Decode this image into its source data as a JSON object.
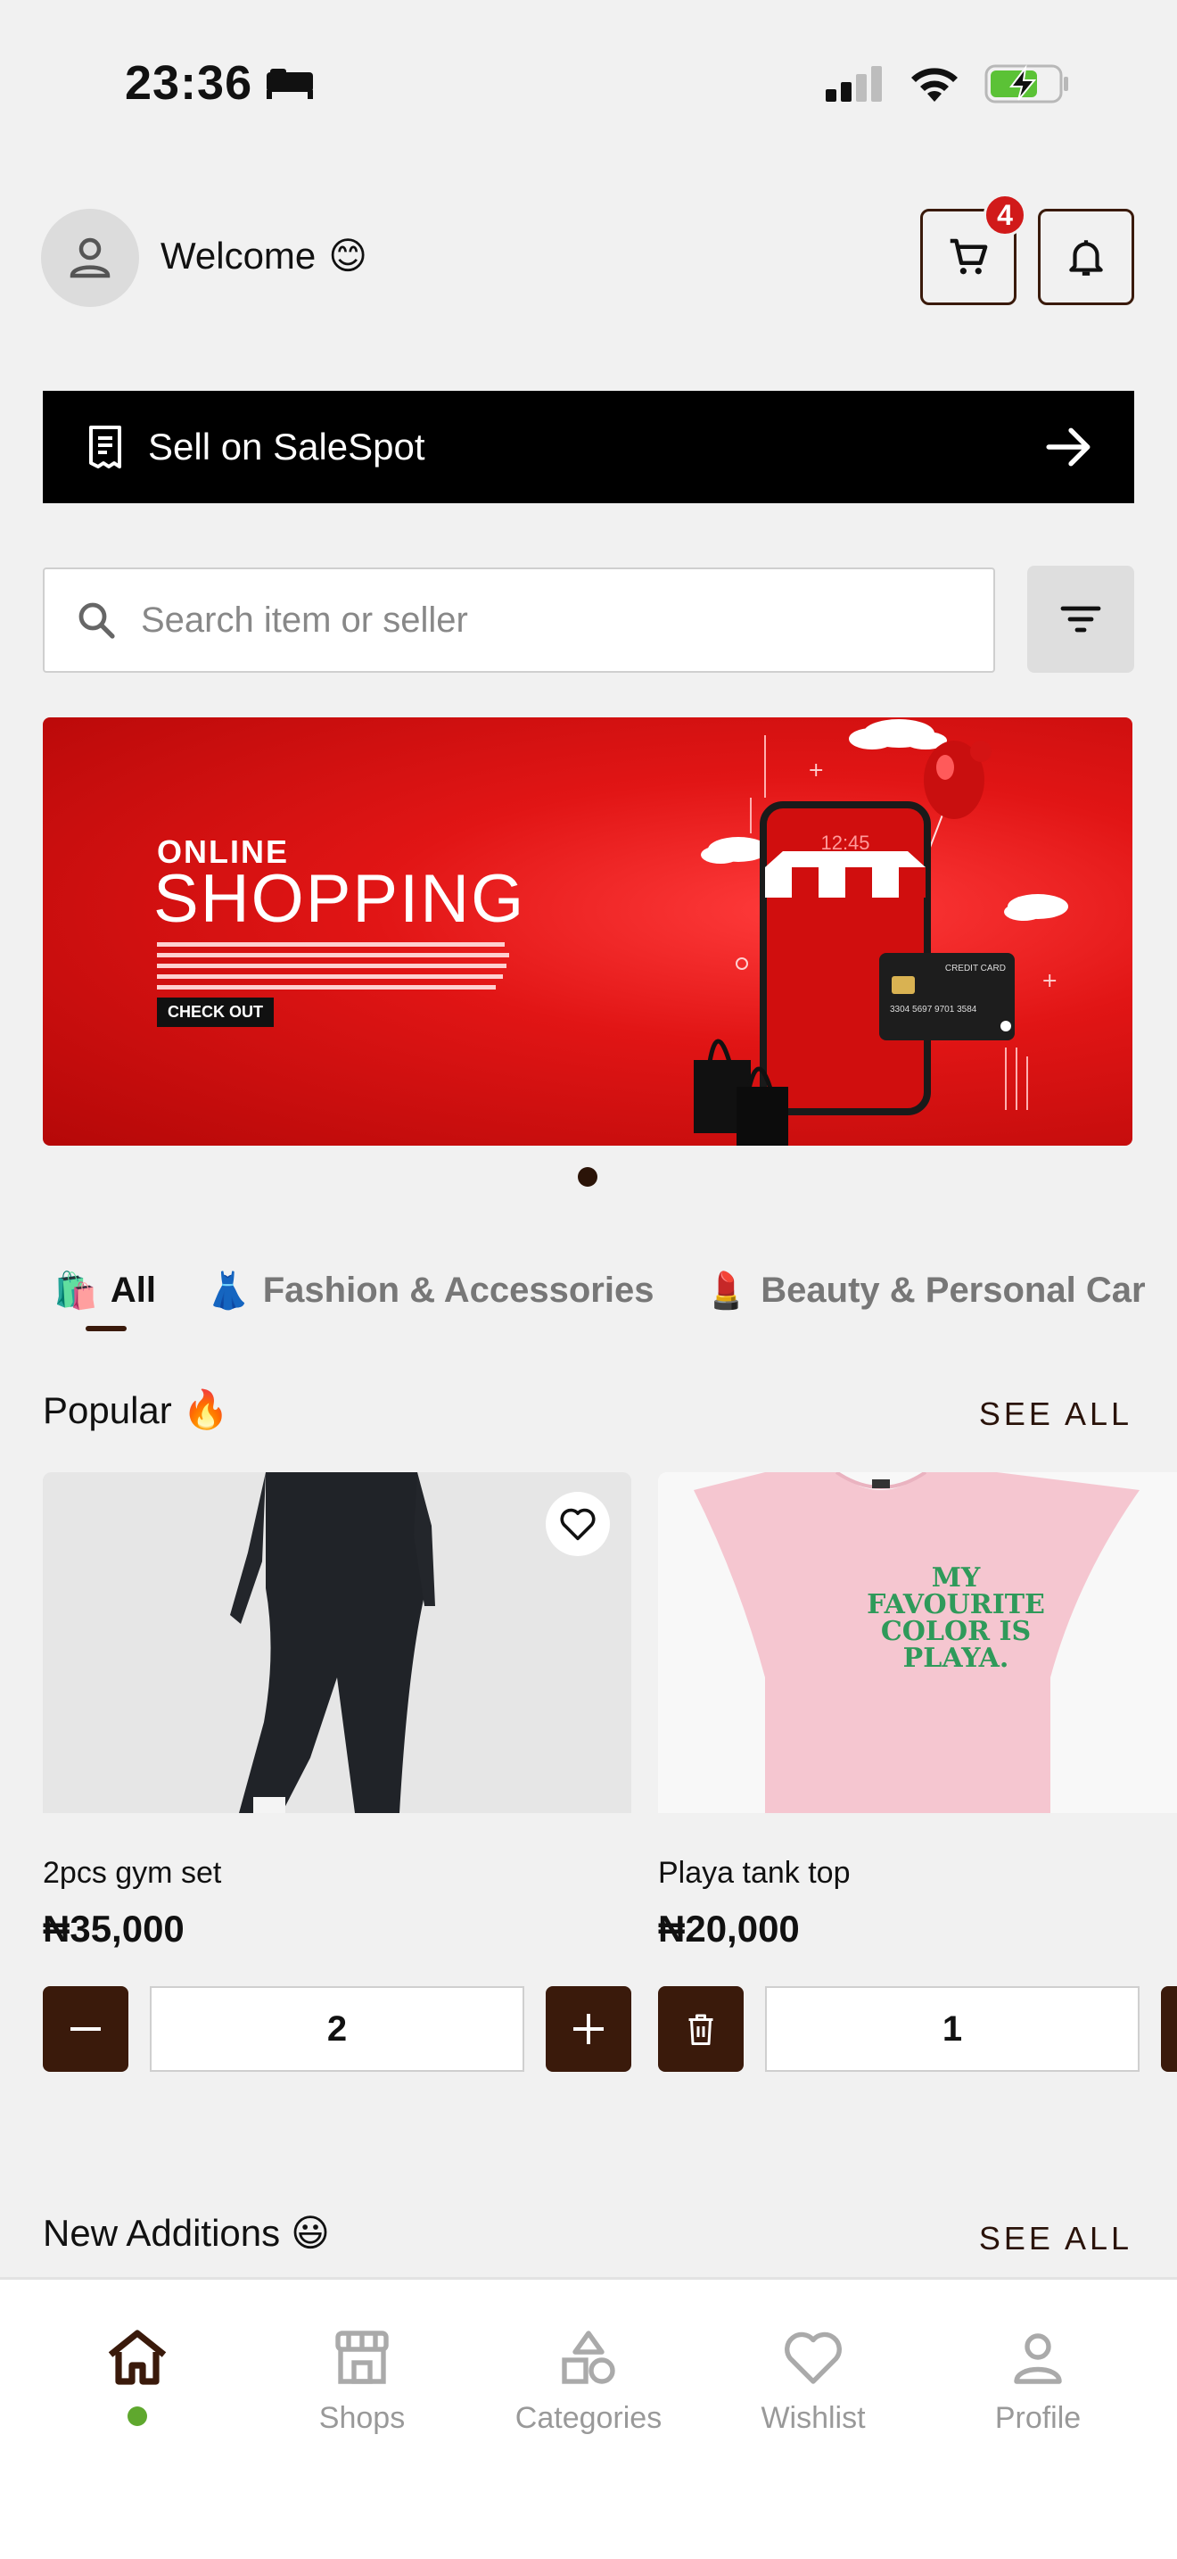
{
  "status_bar": {
    "time": "23:36",
    "battery": "charging"
  },
  "header": {
    "welcome_text": "Welcome",
    "welcome_emoji": "😊",
    "cart_count": "4"
  },
  "sell_bar": {
    "label": "Sell on SaleSpot"
  },
  "search": {
    "placeholder": "Search item or seller",
    "value": ""
  },
  "banner": {
    "line1": "ONLINE",
    "line2": "SHOPPING",
    "cta": "CHECK OUT",
    "phone_time": "12:45",
    "card_label": "CREDIT CARD",
    "card_number": "3304 5697 9701 3584"
  },
  "categories": [
    {
      "emoji": "🛍️",
      "label": "All",
      "active": true
    },
    {
      "emoji": "👗",
      "label": "Fashion & Accessories",
      "active": false
    },
    {
      "emoji": "💄",
      "label": "Beauty & Personal Car",
      "active": false
    }
  ],
  "popular": {
    "title": "Popular",
    "emoji": "🔥",
    "see_all": "SEE ALL",
    "products": [
      {
        "name": "2pcs gym set",
        "price": "₦35,000",
        "quantity": "2"
      },
      {
        "name": "Playa tank top",
        "price": "₦20,000",
        "quantity": "1",
        "print_text": "MY FAVOURITE COLOR IS PLAYA."
      }
    ]
  },
  "new_additions": {
    "title": "New Additions",
    "emoji": "😃",
    "see_all": "SEE ALL"
  },
  "bottom_nav": [
    {
      "icon": "home-icon",
      "label": ""
    },
    {
      "icon": "shop-icon",
      "label": "Shops"
    },
    {
      "icon": "categories-icon",
      "label": "Categories"
    },
    {
      "icon": "heart-icon",
      "label": "Wishlist"
    },
    {
      "icon": "profile-icon",
      "label": "Profile"
    }
  ],
  "colors": {
    "brand": "#3a1a0b",
    "badge": "#d11a1a",
    "active_dot": "#5fa82e",
    "banner": "#e11515"
  }
}
